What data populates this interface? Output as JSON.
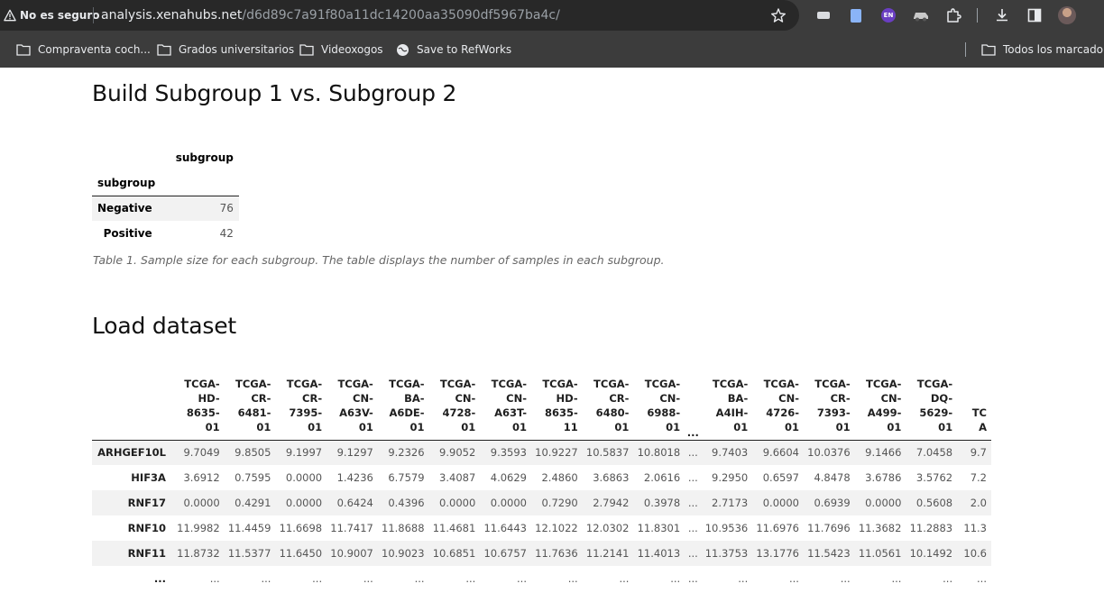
{
  "browser": {
    "security_text": "No es seguro",
    "url_host": "analysis.xenahubs.net",
    "url_path": "/d6d89c7a91f80a11dc14200aa35090df5967ba4c/",
    "extension_en_label": "EN",
    "bookmarks": [
      {
        "label": "Compraventa coch...",
        "icon": "folder-icon"
      },
      {
        "label": "Grados universitarios",
        "icon": "folder-icon"
      },
      {
        "label": "Videoxogos",
        "icon": "folder-icon"
      },
      {
        "label": "Save to RefWorks",
        "icon": "globe-icon"
      }
    ],
    "all_bookmarks": "Todos los marcadores"
  },
  "page": {
    "title_build": "Build Subgroup 1 vs. Subgroup 2",
    "subgroup_table": {
      "column_header": "subgroup",
      "index_name": "subgroup",
      "rows": [
        {
          "label": "Negative",
          "value": "76"
        },
        {
          "label": "Positive",
          "value": "42"
        }
      ]
    },
    "caption": "Table 1. Sample size for each subgroup. The table displays the number of samples in each subgroup.",
    "title_load": "Load dataset",
    "dataset": {
      "columns": [
        [
          "TCGA-",
          "HD-",
          "8635-",
          "01"
        ],
        [
          "TCGA-",
          "CR-",
          "6481-",
          "01"
        ],
        [
          "TCGA-",
          "CR-",
          "7395-",
          "01"
        ],
        [
          "TCGA-",
          "CN-",
          "A63V-",
          "01"
        ],
        [
          "TCGA-",
          "BA-",
          "A6DE-",
          "01"
        ],
        [
          "TCGA-",
          "CN-",
          "4728-",
          "01"
        ],
        [
          "TCGA-",
          "CN-",
          "A63T-",
          "01"
        ],
        [
          "TCGA-",
          "HD-",
          "8635-",
          "11"
        ],
        [
          "TCGA-",
          "CR-",
          "6480-",
          "01"
        ],
        [
          "TCGA-",
          "CN-",
          "6988-",
          "01"
        ],
        [
          "..."
        ],
        [
          "TCGA-",
          "BA-",
          "A4IH-",
          "01"
        ],
        [
          "TCGA-",
          "CN-",
          "4726-",
          "01"
        ],
        [
          "TCGA-",
          "CR-",
          "7393-",
          "01"
        ],
        [
          "TCGA-",
          "CN-",
          "A499-",
          "01"
        ],
        [
          "TCGA-",
          "DQ-",
          "5629-",
          "01"
        ],
        [
          "TC",
          "",
          "",
          "A"
        ]
      ],
      "rows": [
        {
          "label": "ARHGEF10L",
          "values": [
            "9.7049",
            "9.8505",
            "9.1997",
            "9.1297",
            "9.2326",
            "9.9052",
            "9.3593",
            "10.9227",
            "10.5837",
            "10.8018",
            "...",
            "9.7403",
            "9.6604",
            "10.0376",
            "9.1466",
            "7.0458",
            "9.7"
          ]
        },
        {
          "label": "HIF3A",
          "values": [
            "3.6912",
            "0.7595",
            "0.0000",
            "1.4236",
            "6.7579",
            "3.4087",
            "4.0629",
            "2.4860",
            "3.6863",
            "2.0616",
            "...",
            "9.2950",
            "0.6597",
            "4.8478",
            "3.6786",
            "3.5762",
            "7.2"
          ]
        },
        {
          "label": "RNF17",
          "values": [
            "0.0000",
            "0.4291",
            "0.0000",
            "0.6424",
            "0.4396",
            "0.0000",
            "0.0000",
            "0.7290",
            "2.7942",
            "0.3978",
            "...",
            "2.7173",
            "0.0000",
            "0.6939",
            "0.0000",
            "0.5608",
            "2.0"
          ]
        },
        {
          "label": "RNF10",
          "values": [
            "11.9982",
            "11.4459",
            "11.6698",
            "11.7417",
            "11.8688",
            "11.4681",
            "11.6443",
            "12.1022",
            "12.0302",
            "11.8301",
            "...",
            "10.9536",
            "11.6976",
            "11.7696",
            "11.3682",
            "11.2883",
            "11.3"
          ]
        },
        {
          "label": "RNF11",
          "values": [
            "11.8732",
            "11.5377",
            "11.6450",
            "10.9007",
            "10.9023",
            "10.6851",
            "10.6757",
            "11.7636",
            "11.2141",
            "11.4013",
            "...",
            "11.3753",
            "13.1776",
            "11.5423",
            "11.0561",
            "10.1492",
            "10.6"
          ]
        },
        {
          "label": "...",
          "values": [
            "...",
            "...",
            "...",
            "...",
            "...",
            "...",
            "...",
            "...",
            "...",
            "...",
            "...",
            "...",
            "...",
            "...",
            "...",
            "...",
            "..."
          ]
        }
      ]
    }
  }
}
